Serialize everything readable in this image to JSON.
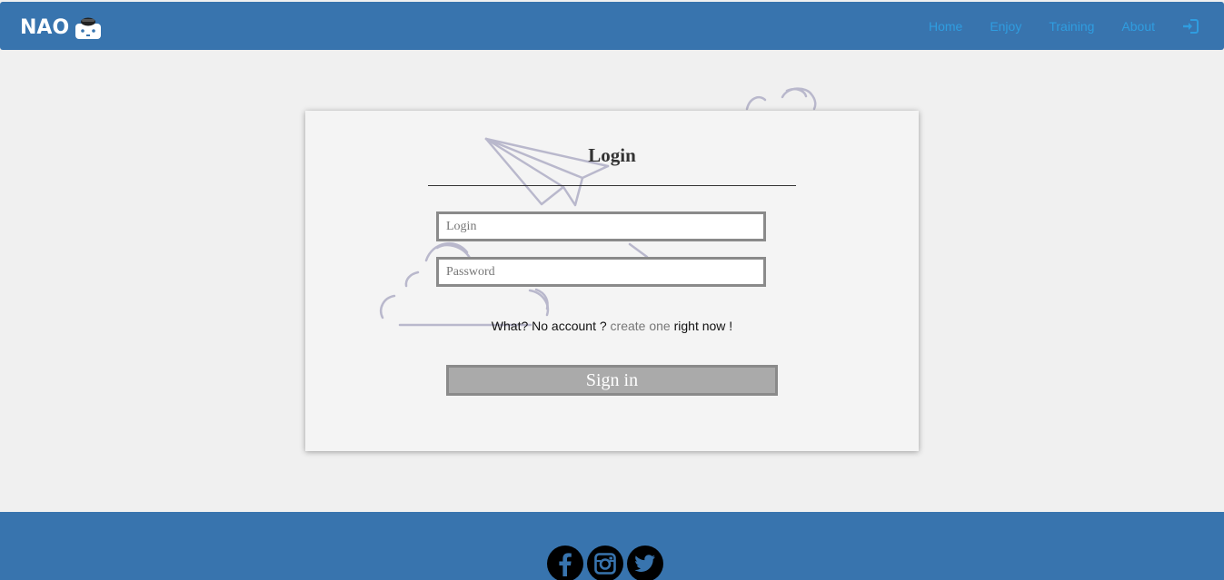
{
  "navbar": {
    "brand": "NAO",
    "links": [
      {
        "label": "Home"
      },
      {
        "label": "Enjoy"
      },
      {
        "label": "Training"
      },
      {
        "label": "About"
      }
    ],
    "link_color": "#2f9de0",
    "bar_color": "#3874ae",
    "login_icon": "sign-in-icon"
  },
  "login_form": {
    "title": "Login",
    "login_placeholder": "Login",
    "password_placeholder": "Password",
    "account_prefix": "What? No account ?",
    "create_link": "create one",
    "account_suffix": "right now !",
    "submit_label": "Sign in"
  },
  "footer": {
    "bar_color": "#3874ae",
    "social_icons": [
      "facebook-icon",
      "instagram-icon",
      "twitter-icon"
    ]
  }
}
